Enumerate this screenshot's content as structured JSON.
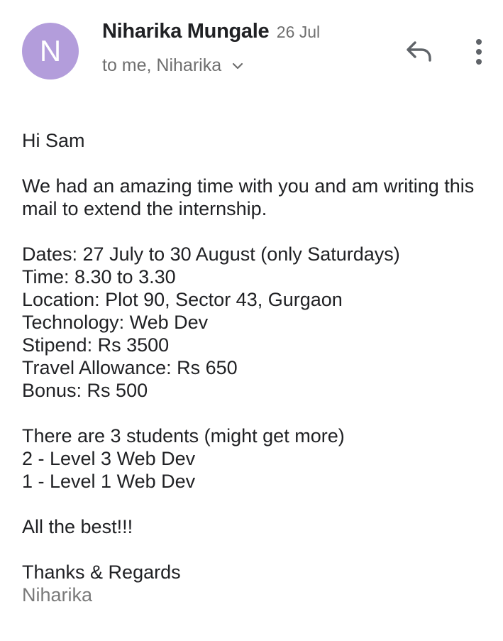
{
  "message": {
    "sender": {
      "initial": "N",
      "name": "Niharika Mungale",
      "avatar_color": "#b39ddb"
    },
    "date": "26 Jul",
    "recipients": "to me, Niharika",
    "actions": {
      "reply_icon": "reply-arrow-icon",
      "more_icon": "vertical-dots-icon",
      "expand_icon": "chevron-down-icon"
    },
    "body": {
      "greeting": "Hi Sam",
      "intro_line1": "We had an amazing time with you and am writing this",
      "intro_line2": "mail to extend the internship.",
      "details": [
        "Dates: 27 July to 30 August (only Saturdays)",
        "Time: 8.30 to 3.30",
        "Location: Plot 90, Sector 43, Gurgaon",
        "Technology: Web Dev",
        "Stipend: Rs 3500",
        "Travel Allowance: Rs 650",
        "Bonus: Rs 500"
      ],
      "students": [
        "There are 3 students (might get more)",
        "2 - Level 3 Web Dev",
        "1 - Level 1 Web Dev"
      ],
      "closing": "All the best!!!",
      "signoff": "Thanks & Regards",
      "signature": "Niharika"
    }
  }
}
